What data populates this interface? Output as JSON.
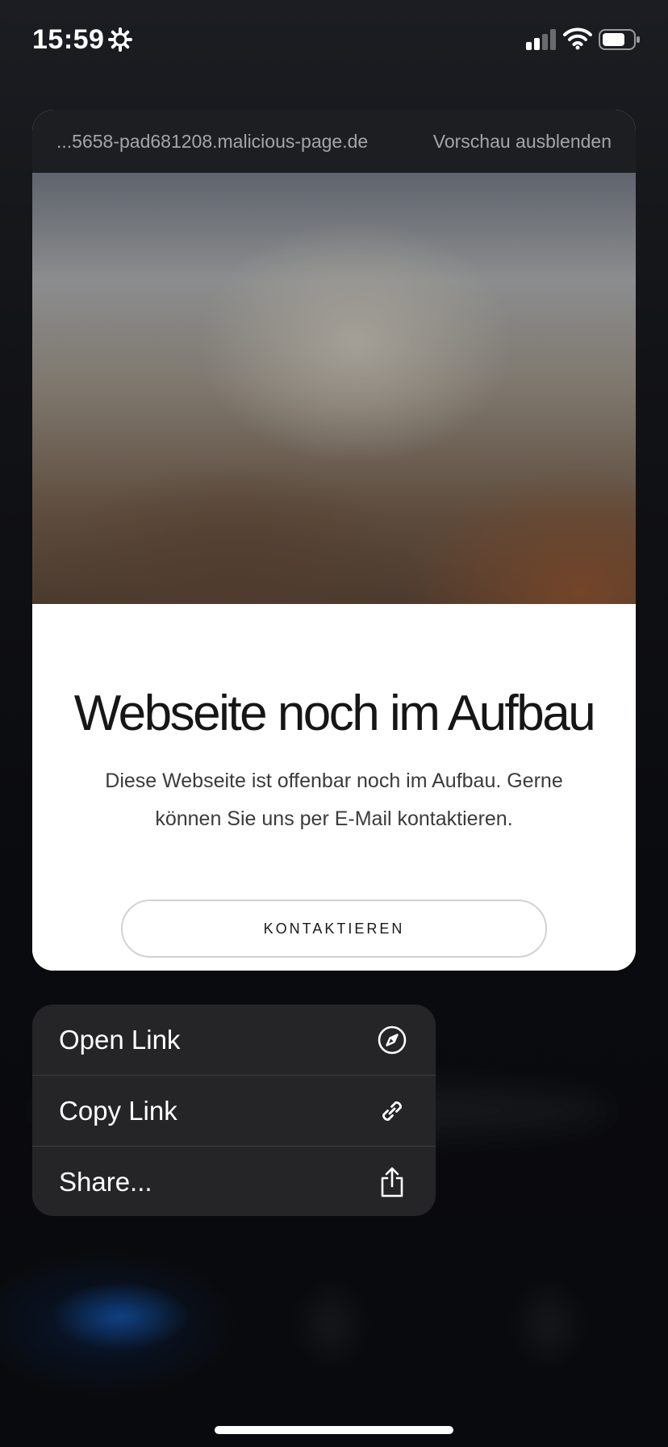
{
  "status_bar": {
    "time": "15:59",
    "gear_icon": "gear-icon",
    "signal_icon": "cellular-signal-icon",
    "wifi_icon": "wifi-icon",
    "battery_icon": "battery-icon"
  },
  "preview": {
    "url": "...5658-pad681208.malicious-page.de",
    "hide_preview_label": "Vorschau ausblenden",
    "heading": "Webseite noch im Aufbau",
    "text": "Diese Webseite ist offenbar noch im Aufbau. Gerne können Sie uns per E-Mail kontaktieren.",
    "contact_button_label": "KONTAKTIEREN"
  },
  "context_menu": {
    "items": [
      {
        "label": "Open Link",
        "icon": "compass-icon"
      },
      {
        "label": "Copy Link",
        "icon": "link-icon"
      },
      {
        "label": "Share...",
        "icon": "share-icon"
      }
    ]
  },
  "colors": {
    "menu_background": "#252528",
    "preview_header_background": "#1d1e22",
    "accent_glow": "#1464c8"
  }
}
